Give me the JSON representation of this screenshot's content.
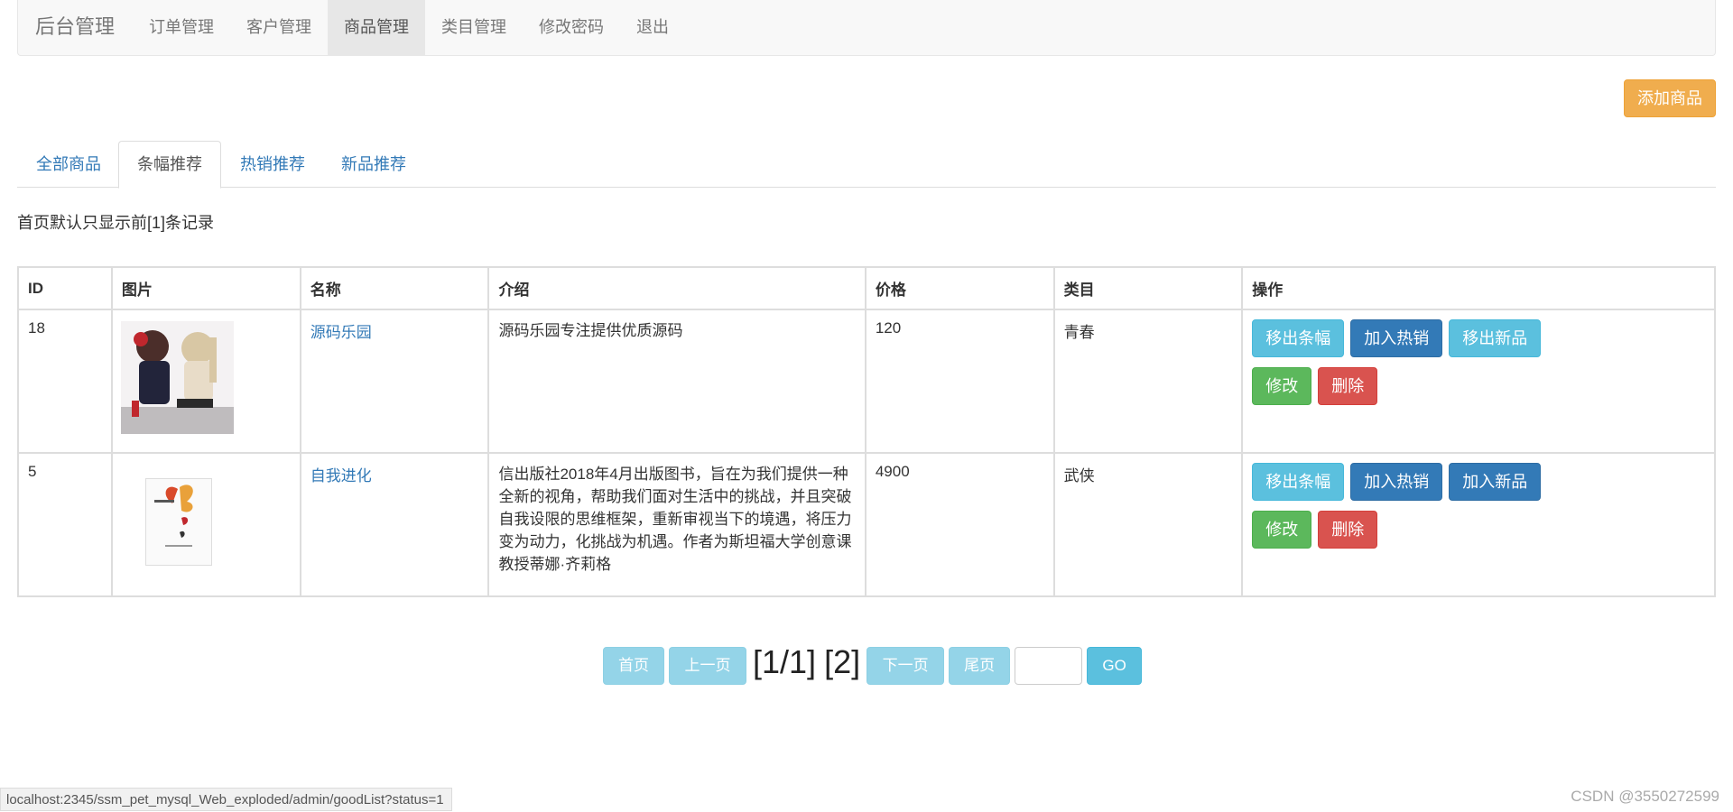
{
  "navbar": {
    "brand": "后台管理",
    "items": [
      "订单管理",
      "客户管理",
      "商品管理",
      "类目管理",
      "修改密码",
      "退出"
    ],
    "active_index": 2
  },
  "add_button": "添加商品",
  "tabs": [
    "全部商品",
    "条幅推荐",
    "热销推荐",
    "新品推荐"
  ],
  "active_tab": 1,
  "notice": "首页默认只显示前[1]条记录",
  "table": {
    "headers": [
      "ID",
      "图片",
      "名称",
      "介绍",
      "价格",
      "类目",
      "操作"
    ],
    "rows": [
      {
        "id": "18",
        "name": "源码乐园",
        "intro": "源码乐园专注提供优质源码",
        "price": "120",
        "category": "青春",
        "actions_row1": [
          "移出条幅",
          "加入热销",
          "移出新品"
        ],
        "actions_row2": [
          "修改",
          "删除"
        ]
      },
      {
        "id": "5",
        "name": "自我进化",
        "intro": "信出版社2018年4月出版图书，旨在为我们提供一种全新的视角，帮助我们面对生活中的挑战，并且突破自我设限的思维框架，重新审视当下的境遇，将压力变为动力，化挑战为机遇。作者为斯坦福大学创意课教授蒂娜·齐莉格",
        "price": "4900",
        "category": "武侠",
        "actions_row1": [
          "移出条幅",
          "加入热销",
          "加入新品"
        ],
        "actions_row2": [
          "修改",
          "删除"
        ]
      }
    ]
  },
  "pager": {
    "first": "首页",
    "prev": "上一页",
    "info": "[1/1]",
    "page": "[2]",
    "next": "下一页",
    "last": "尾页",
    "go": "GO"
  },
  "status_url": "localhost:2345/ssm_pet_mysql_Web_exploded/admin/goodList?status=1",
  "watermark": "CSDN @3550272599",
  "colors": {
    "info": "#5bc0de",
    "primary": "#337ab7",
    "success": "#5cb85c",
    "danger": "#d9534f",
    "warning": "#f0ad4e"
  }
}
